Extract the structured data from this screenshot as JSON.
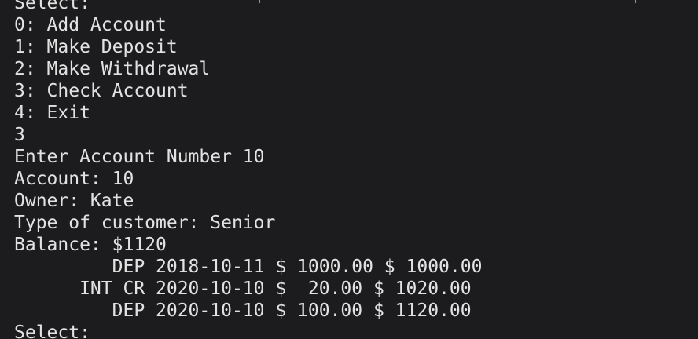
{
  "terminal": {
    "lines": [
      "Select:",
      "0: Add Account",
      "1: Make Deposit",
      "2: Make Withdrawal",
      "3: Check Account",
      "4: Exit",
      "3",
      "Enter Account Number 10",
      "Account: 10",
      "Owner: Kate",
      "Type of customer: Senior",
      "Balance: $1120",
      "         DEP 2018-10-11 $ 1000.00 $ 1000.00",
      "      INT CR 2020-10-10 $  20.00 $ 1020.00",
      "         DEP 2020-10-10 $ 100.00 $ 1120.00",
      "Select:"
    ]
  }
}
